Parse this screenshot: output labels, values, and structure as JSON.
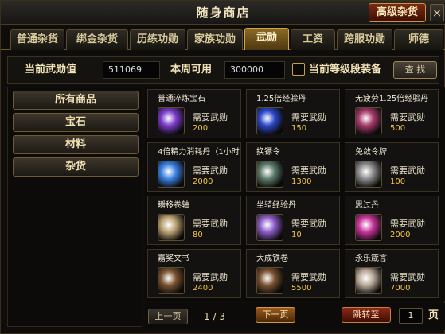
{
  "window": {
    "title": "随身商店",
    "advanced_button": "高级杂货",
    "close_glyph": "×"
  },
  "tabs": [
    {
      "label": "普通杂货",
      "active": false
    },
    {
      "label": "绑金杂货",
      "active": false
    },
    {
      "label": "历练功勋",
      "active": false
    },
    {
      "label": "家族功勋",
      "active": false
    },
    {
      "label": "武勋",
      "active": true
    },
    {
      "label": "工资",
      "active": false
    },
    {
      "label": "跨服功勋",
      "active": false
    },
    {
      "label": "师德",
      "active": false
    }
  ],
  "info": {
    "current_label": "当前武勋值",
    "current_value": "511069",
    "weekly_label": "本周可用",
    "weekly_value": "300000",
    "level_filter_label": "当前等级段装备",
    "level_filter_checked": false,
    "search_button": "查 找"
  },
  "categories": [
    {
      "label": "所有商品"
    },
    {
      "label": "宝石"
    },
    {
      "label": "材料"
    },
    {
      "label": "杂货"
    }
  ],
  "items": [
    {
      "name": "普通淬炼宝石",
      "label": "需要武勋",
      "price": "200",
      "icon": "gem-purple-icon",
      "color": "#7a3cc8"
    },
    {
      "name": "1.25倍经验丹",
      "label": "需要武勋",
      "price": "150",
      "icon": "exp-orb-blue-icon",
      "color": "#2c48c9"
    },
    {
      "name": "无疲劳1.25倍经验丹",
      "label": "需要武勋",
      "price": "500",
      "icon": "exp-orb-red-icon",
      "color": "#a53a6a"
    },
    {
      "name": "4倍精力消耗丹（1小时）",
      "label": "需要武勋",
      "price": "2000",
      "icon": "energy-pill-icon",
      "color": "#3a80e0"
    },
    {
      "name": "换镖令",
      "label": "需要武勋",
      "price": "1300",
      "icon": "escort-token-icon",
      "color": "#5c7a6a"
    },
    {
      "name": "免敛令牌",
      "label": "需要武勋",
      "price": "100",
      "icon": "exempt-token-icon",
      "color": "#8a8a8a"
    },
    {
      "name": "瞬移卷轴",
      "label": "需要武勋",
      "price": "80",
      "icon": "teleport-scroll-icon",
      "color": "#b8a070"
    },
    {
      "name": "坐骑经验丹",
      "label": "需要武勋",
      "price": "10",
      "icon": "mount-exp-potion-icon",
      "color": "#8a5ac8"
    },
    {
      "name": "思过丹",
      "label": "需要武勋",
      "price": "2000",
      "icon": "repent-pill-icon",
      "color": "#c8329a"
    },
    {
      "name": "嘉奖文书",
      "label": "需要武勋",
      "price": "2400",
      "icon": "award-document-icon",
      "color": "#7a5230"
    },
    {
      "name": "大成铁卷",
      "label": "需要武勋",
      "price": "5500",
      "icon": "iron-scroll-icon",
      "color": "#7a5230"
    },
    {
      "name": "永乐箴言",
      "label": "需要武勋",
      "price": "7000",
      "icon": "motto-scroll-icon",
      "color": "#b8a898"
    }
  ],
  "pager": {
    "prev_button": "上一页",
    "current_page": "1",
    "separator": "/",
    "total_pages": "3",
    "next_button": "下一页",
    "jump_button": "跳转至",
    "jump_value": "1",
    "page_suffix": "页"
  }
}
